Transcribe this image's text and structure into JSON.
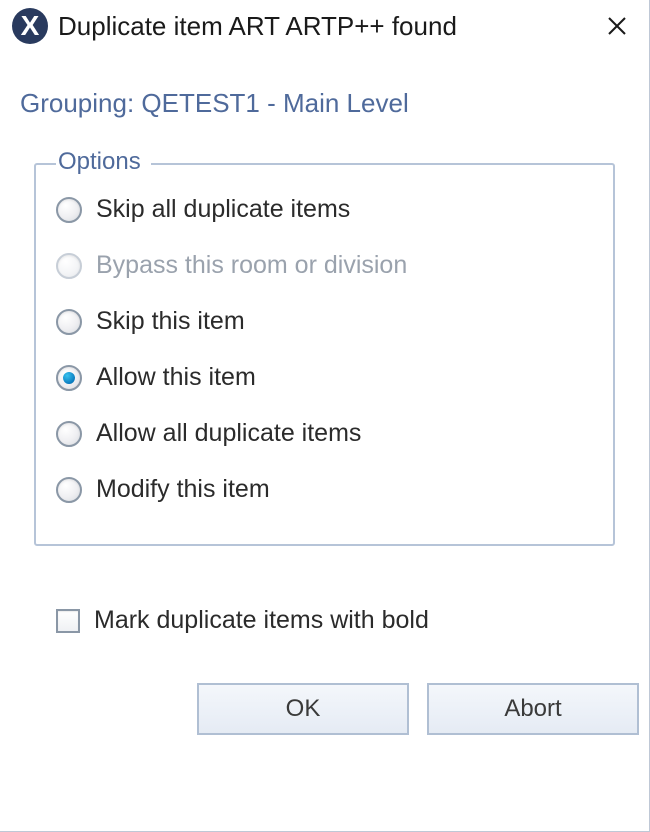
{
  "titlebar": {
    "title": "Duplicate item ART ARTP++ found"
  },
  "grouping": {
    "text": "Grouping: QETEST1  -  Main Level"
  },
  "options": {
    "legend": "Options",
    "items": [
      {
        "label": "Skip all duplicate items",
        "selected": false,
        "disabled": false
      },
      {
        "label": "Bypass this room or division",
        "selected": false,
        "disabled": true
      },
      {
        "label": "Skip this item",
        "selected": false,
        "disabled": false
      },
      {
        "label": "Allow this item",
        "selected": true,
        "disabled": false
      },
      {
        "label": "Allow all duplicate items",
        "selected": false,
        "disabled": false
      },
      {
        "label": "Modify this item",
        "selected": false,
        "disabled": false
      }
    ]
  },
  "checkbox": {
    "label": "Mark duplicate items with bold",
    "checked": false
  },
  "buttons": {
    "ok": "OK",
    "abort": "Abort"
  }
}
